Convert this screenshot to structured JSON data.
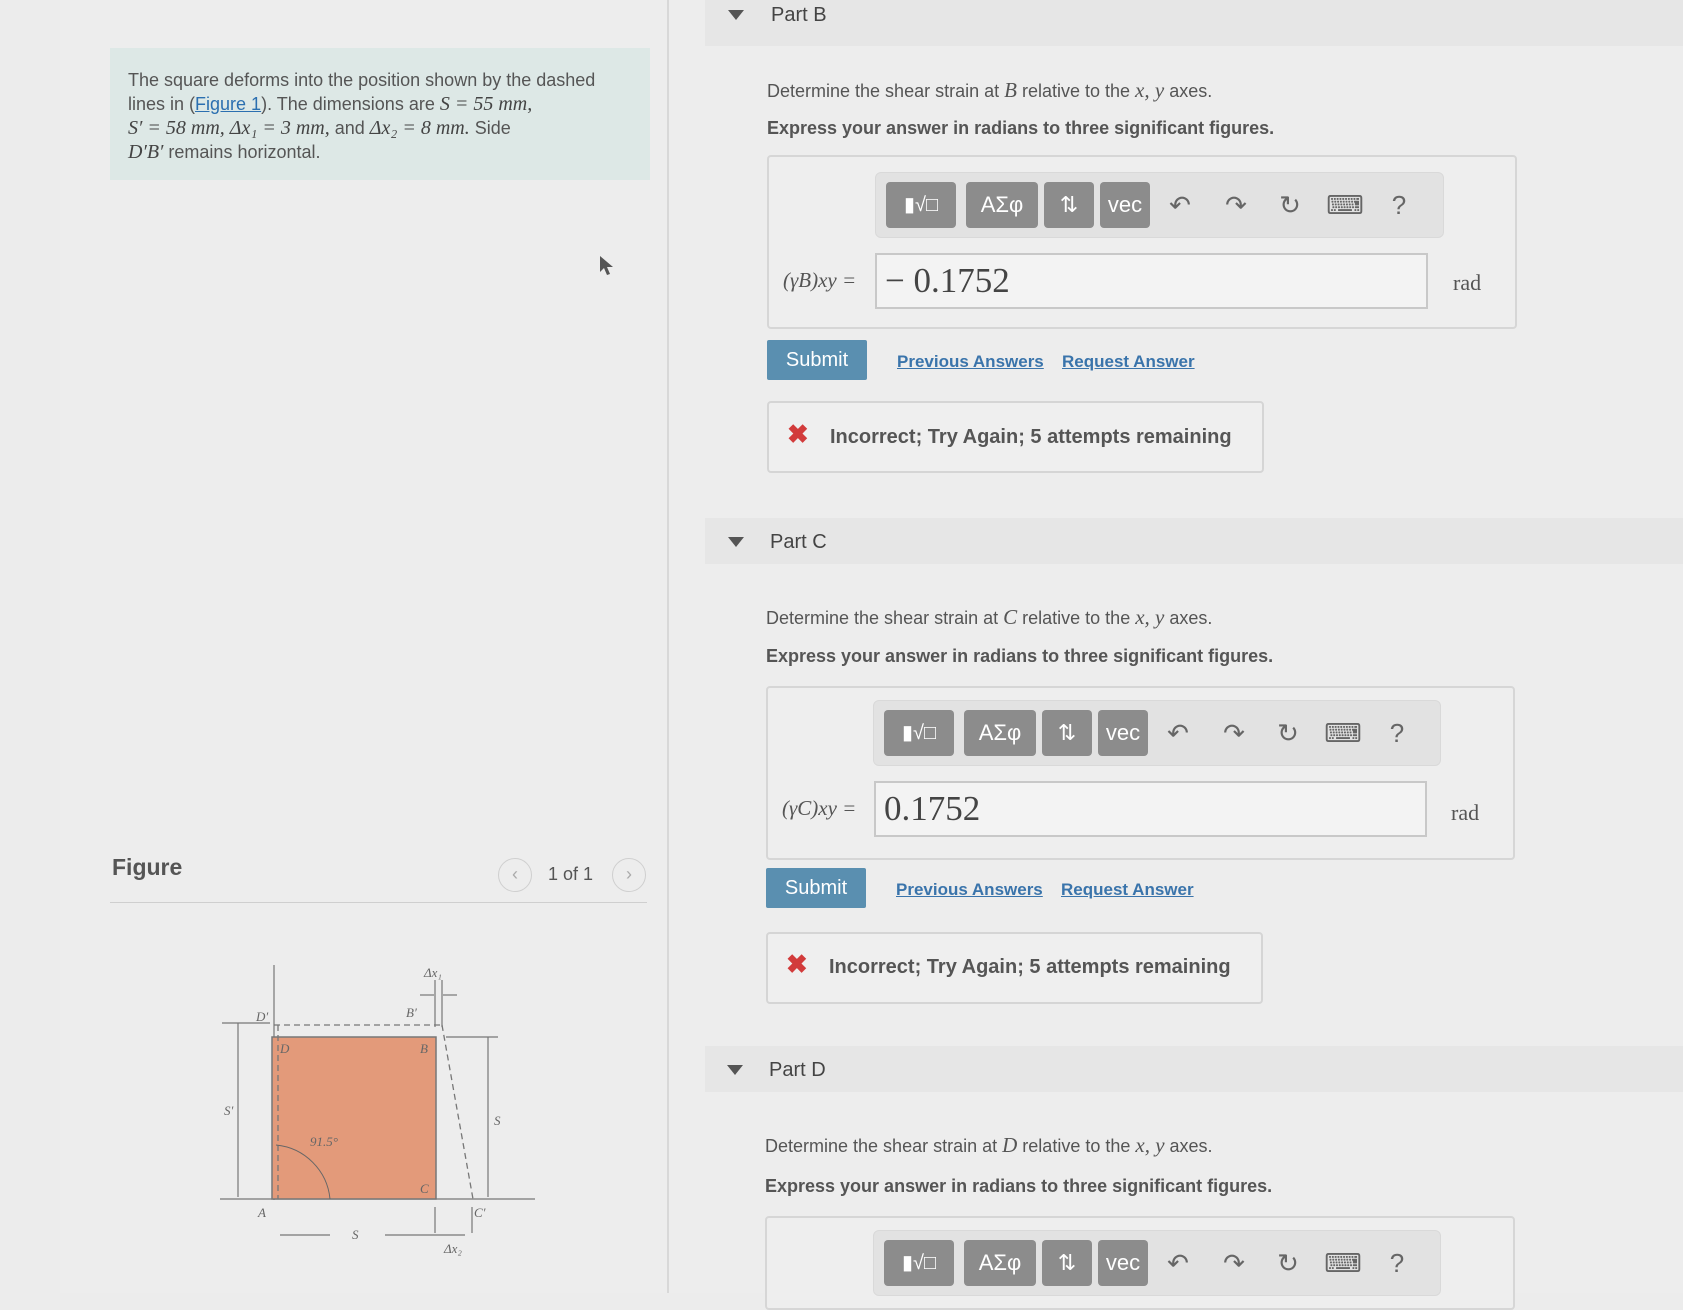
{
  "problem": {
    "t1": "The square deforms into the position shown by the dashed",
    "t2": "lines in (",
    "figure_link": "Figure 1",
    "t3": "). The dimensions are ",
    "m_s": "S = 55 mm,",
    "m_sp": "S′ = 58 mm, Δx₁ = 3 mm,",
    "t4": " and ",
    "m_dx2": "Δx₂ = 8 mm.",
    "t5": " Side",
    "m_db": "D′B′",
    "t6": " remains horizontal."
  },
  "figure": {
    "label": "Figure",
    "pager": "1 of 1",
    "labels": {
      "D_prime": "D′",
      "B_prime": "B′",
      "D": "D",
      "B": "B",
      "A": "A",
      "C": "C",
      "C_prime": "C′",
      "S_prime": "S′",
      "S_right": "S",
      "S_bottom": "S",
      "angle": "91.5°",
      "dx1": "Δx₁",
      "dx2": "Δx₂"
    }
  },
  "toolbar": {
    "templates": "▮√□",
    "greek": "ΑΣφ",
    "arrows": "⇅",
    "vec": "vec",
    "undo": "↶",
    "redo": "↷",
    "reset": "↻",
    "keyboard": "⌨",
    "help": "?"
  },
  "parts": [
    {
      "title": "Part B",
      "prompt_a": "Determine the shear strain at ",
      "prompt_pt": "B",
      "prompt_b": " relative to the ",
      "prompt_axes": "x, y",
      "prompt_c": " axes.",
      "instructions": "Express your answer in radians to three significant figures.",
      "var_label": "(γB)xy =",
      "answer": "− 0.1752",
      "unit": "rad",
      "submit": "Submit",
      "previous": "Previous Answers",
      "request": "Request Answer",
      "feedback": "Incorrect; Try Again; 5 attempts remaining"
    },
    {
      "title": "Part C",
      "prompt_a": "Determine the shear strain at ",
      "prompt_pt": "C",
      "prompt_b": " relative to the ",
      "prompt_axes": "x, y",
      "prompt_c": " axes.",
      "instructions": "Express your answer in radians to three significant figures.",
      "var_label": "(γC)xy =",
      "answer": "0.1752",
      "unit": "rad",
      "submit": "Submit",
      "previous": "Previous Answers",
      "request": "Request Answer",
      "feedback": "Incorrect; Try Again; 5 attempts remaining"
    },
    {
      "title": "Part D",
      "prompt_a": "Determine the shear strain at ",
      "prompt_pt": "D",
      "prompt_b": " relative to the ",
      "prompt_axes": "x, y",
      "prompt_c": " axes.",
      "instructions": "Express your answer in radians to three significant figures."
    }
  ]
}
